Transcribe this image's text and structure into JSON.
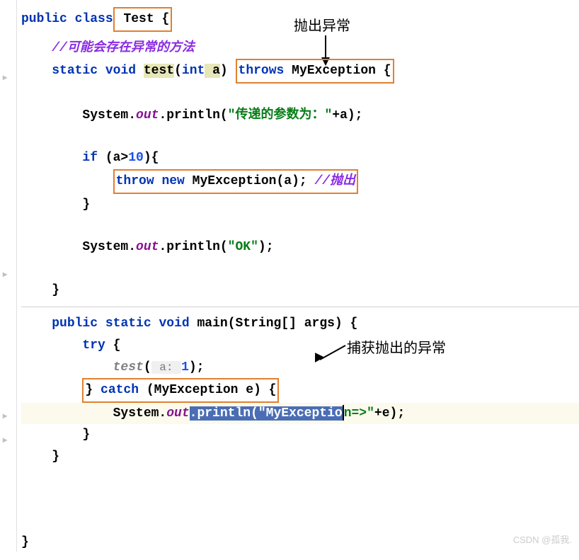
{
  "annotations": {
    "throw_label": "抛出异常",
    "catch_label": "捕获抛出的异常"
  },
  "code": {
    "l1_kw1": "public",
    "l1_kw2": "class",
    "l1_cls": " Test {",
    "l2_comment": "//可能会存在异常的方法",
    "l3_kw1": "static",
    "l3_kw2": "void",
    "l3_method": "test",
    "l3_paren_open": "(",
    "l3_kw3": "int",
    "l3_param": " a",
    "l3_paren_close": ") ",
    "l3_throws": "throws",
    "l3_exc": " MyException {",
    "l4_a": "System.",
    "l4_out": "out",
    "l4_b": ".println(",
    "l4_str": "\"传递的参数为：\"",
    "l4_c": "+a);",
    "l5_if": "if",
    "l5_cond": " (a>",
    "l5_num": "10",
    "l5_close": "){",
    "l6_throw": "throw",
    "l6_new": "new",
    "l6_exc": " MyException(a); ",
    "l6_comment": "//抛出",
    "l7_brace": "}",
    "l8_a": "System.",
    "l8_out": "out",
    "l8_b": ".println(",
    "l8_str": "\"OK\"",
    "l8_c": ");",
    "l9_brace": "}",
    "l10_kw1": "public",
    "l10_kw2": "static",
    "l10_kw3": "void",
    "l10_method": " main(String[] args) {",
    "l11_try": "try",
    "l11_brace": " {",
    "l12_call": "test",
    "l12_hint": " a: ",
    "l12_arg": "1",
    "l12_close": ");",
    "l12_open": "(",
    "l13_brace": "} ",
    "l13_catch": "catch",
    "l13_param": " (MyException e) {",
    "l14_a": "System.",
    "l14_out": "out",
    "l14_sel": ".println(\"MyExceptio",
    "l14_rest1": "n=>\"",
    "l14_rest2": "+e);",
    "l15_brace": "}",
    "l16_brace": "}",
    "l17_brace": "}"
  },
  "watermark": "CSDN @孤我."
}
